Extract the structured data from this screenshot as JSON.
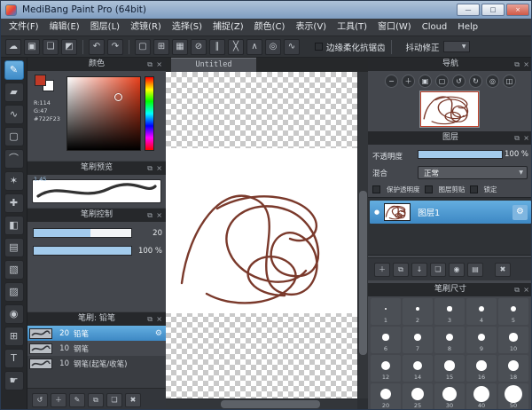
{
  "window": {
    "title": "MediBang Paint Pro (64bit)",
    "controls": [
      {
        "name": "minimize-button",
        "glyph": "—"
      },
      {
        "name": "maximize-button",
        "glyph": "□"
      },
      {
        "name": "close-button",
        "glyph": "×"
      }
    ]
  },
  "menu": {
    "items": [
      "文件(F)",
      "编辑(E)",
      "图层(L)",
      "滤镜(R)",
      "选择(S)",
      "捕捉(Z)",
      "颜色(C)",
      "表示(V)",
      "工具(T)",
      "窗口(W)",
      "Cloud",
      "Help"
    ]
  },
  "toolbar": {
    "icons": [
      {
        "name": "cloud-icon",
        "glyph": "☁"
      },
      {
        "name": "save-icon",
        "glyph": "▣"
      },
      {
        "name": "material-icon",
        "glyph": "❏"
      },
      {
        "name": "color-swap-icon",
        "glyph": "◩"
      },
      {
        "name": "undo-icon",
        "glyph": "↶"
      },
      {
        "name": "redo-icon",
        "glyph": "↷"
      },
      {
        "name": "select-icon",
        "glyph": "▢"
      },
      {
        "name": "transform-icon",
        "glyph": "⊞"
      },
      {
        "name": "grid-icon",
        "glyph": "▦"
      },
      {
        "name": "snap-off-icon",
        "glyph": "⊘"
      },
      {
        "name": "snap-parallel-icon",
        "glyph": "∥"
      },
      {
        "name": "snap-cross-icon",
        "glyph": "╳"
      },
      {
        "name": "snap-vanishing-icon",
        "glyph": "∧"
      },
      {
        "name": "snap-circle-icon",
        "glyph": "◎"
      },
      {
        "name": "snap-curve-icon",
        "glyph": "∿"
      }
    ],
    "antialias_label": "边缘柔化抗锯齿",
    "stabilizer_label": "抖动修正"
  },
  "tools": [
    {
      "name": "brush-tool",
      "glyph": "✎",
      "selected": true
    },
    {
      "name": "eraser-tool",
      "glyph": "▰",
      "selected": false
    },
    {
      "name": "smudge-tool",
      "glyph": "∿",
      "selected": false
    },
    {
      "name": "rect-select-tool",
      "glyph": "▢",
      "selected": false
    },
    {
      "name": "lasso-select-tool",
      "glyph": "⌒",
      "selected": false
    },
    {
      "name": "magic-wand-tool",
      "glyph": "✶",
      "selected": false
    },
    {
      "name": "move-tool",
      "glyph": "✚",
      "selected": false
    },
    {
      "name": "fill-bucket-tool",
      "glyph": "◧",
      "selected": false
    },
    {
      "name": "gradient-tool",
      "glyph": "▤",
      "selected": false
    },
    {
      "name": "select-pen-tool",
      "glyph": "▧",
      "selected": false
    },
    {
      "name": "select-eraser-tool",
      "glyph": "▨",
      "selected": false
    },
    {
      "name": "eyedropper-tool",
      "glyph": "◉",
      "selected": false
    },
    {
      "name": "operation-tool",
      "glyph": "⊞",
      "selected": false
    },
    {
      "name": "text-tool",
      "glyph": "T",
      "selected": false
    },
    {
      "name": "hand-tool",
      "glyph": "☛",
      "selected": false
    }
  ],
  "panels": {
    "header_icons": [
      {
        "name": "popout-panel-icon",
        "glyph": "⧉"
      },
      {
        "name": "close-panel-icon",
        "glyph": "×"
      }
    ],
    "color": {
      "title": "颜色",
      "r_label": "R:114",
      "g_label": "G:47",
      "hex_label": "#722F23",
      "foreground": "#c13a27",
      "background": "#ffffff"
    },
    "brush_preview": {
      "title": "笔刷预览",
      "scale": "1.45"
    },
    "brush_control": {
      "title": "笔刷控制",
      "rows": [
        {
          "name": "brush-size-slider",
          "value": "20",
          "fill": 58
        },
        {
          "name": "brush-opacity-slider",
          "value": "100 %",
          "fill": 100
        }
      ]
    },
    "brushes": {
      "title": "笔刷: 铅笔",
      "items": [
        {
          "size": "20",
          "name": "铅笔",
          "selected": true
        },
        {
          "size": "10",
          "name": "钢笔",
          "selected": false
        },
        {
          "size": "10",
          "name": "钢笔(起笔/收笔)",
          "selected": false
        }
      ],
      "buttons": [
        {
          "name": "sync-brush-icon",
          "glyph": "↺"
        },
        {
          "name": "add-brush-icon",
          "glyph": "＋"
        },
        {
          "name": "edit-brush-icon",
          "glyph": "✎"
        },
        {
          "name": "duplicate-brush-icon",
          "glyph": "⧉"
        },
        {
          "name": "brush-folder-icon",
          "glyph": "❏"
        },
        {
          "name": "delete-brush-icon",
          "glyph": "✖"
        }
      ]
    },
    "navigator": {
      "title": "导航",
      "buttons": [
        {
          "name": "zoom-out-icon",
          "glyph": "−"
        },
        {
          "name": "zoom-in-icon",
          "glyph": "＋"
        },
        {
          "name": "fit-screen-icon",
          "glyph": "▣"
        },
        {
          "name": "actual-size-icon",
          "glyph": "▢"
        },
        {
          "name": "rotate-left-icon",
          "glyph": "↺"
        },
        {
          "name": "rotate-right-icon",
          "glyph": "↻"
        },
        {
          "name": "reset-view-icon",
          "glyph": "◎"
        },
        {
          "name": "flip-view-icon",
          "glyph": "◫"
        }
      ]
    },
    "layers": {
      "title": "图层",
      "opacity_label": "不透明度",
      "opacity_value": "100 %",
      "blend_label": "混合",
      "blend_value": "正常",
      "checks": [
        "保护透明度",
        "图层剪贴",
        "锁定"
      ],
      "layer": {
        "name": "图层1"
      },
      "buttons": [
        {
          "name": "add-layer-icon",
          "glyph": "＋"
        },
        {
          "name": "duplicate-layer-icon",
          "glyph": "⧉"
        },
        {
          "name": "merge-layer-icon",
          "glyph": "↓"
        },
        {
          "name": "layer-folder-icon",
          "glyph": "❏"
        },
        {
          "name": "camera-layer-icon",
          "glyph": "◉"
        },
        {
          "name": "convert-layer-icon",
          "glyph": "▤"
        },
        {
          "name": "delete-layer-icon",
          "glyph": "✖"
        }
      ]
    },
    "brush_sizes": {
      "title": "笔刷尺寸",
      "rows": [
        [
          1,
          2,
          3,
          4,
          5
        ],
        [
          6,
          7,
          8,
          9,
          10
        ],
        [
          12,
          14,
          15,
          16,
          18
        ],
        [
          20,
          25,
          30,
          40,
          50
        ]
      ]
    }
  },
  "canvas": {
    "tab": "Untitled"
  },
  "colors": {
    "accent": "#4f9ad6",
    "stroke": "#7a392b"
  }
}
